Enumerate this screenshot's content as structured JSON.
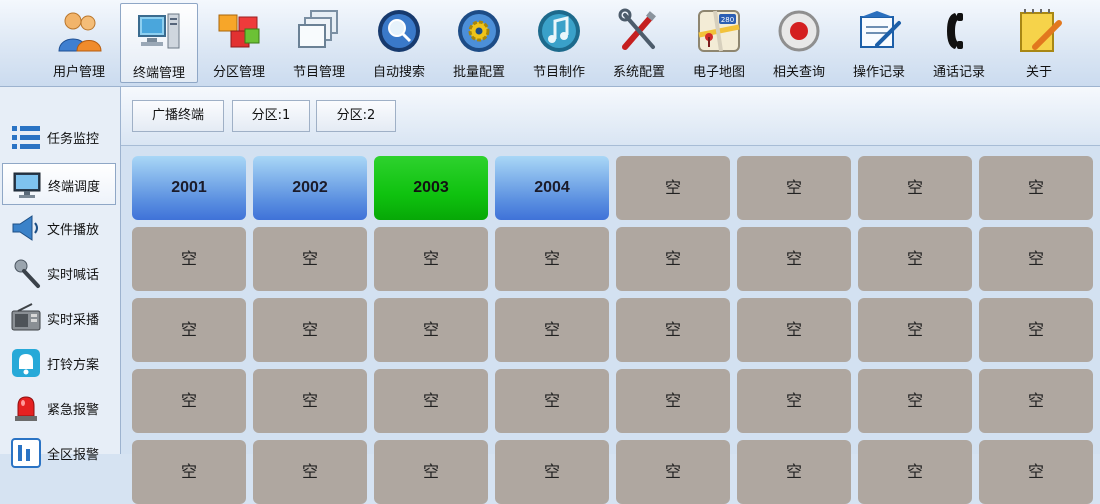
{
  "toolbar": {
    "items": [
      {
        "label": "用户管理",
        "icon": "users-icon",
        "active": false
      },
      {
        "label": "终端管理",
        "icon": "terminal-computer-icon",
        "active": true
      },
      {
        "label": "分区管理",
        "icon": "zone-cubes-icon",
        "active": false
      },
      {
        "label": "节目管理",
        "icon": "program-windows-icon",
        "active": false
      },
      {
        "label": "自动搜索",
        "icon": "search-magnifier-icon",
        "active": false
      },
      {
        "label": "批量配置",
        "icon": "batch-gear-icon",
        "active": false
      },
      {
        "label": "节目制作",
        "icon": "music-note-icon",
        "active": false
      },
      {
        "label": "系统配置",
        "icon": "tools-icon",
        "active": false
      },
      {
        "label": "电子地图",
        "icon": "map-icon",
        "active": false
      },
      {
        "label": "相关查询",
        "icon": "record-query-icon",
        "active": false
      },
      {
        "label": "操作记录",
        "icon": "operation-log-icon",
        "active": false
      },
      {
        "label": "通话记录",
        "icon": "phone-handset-icon",
        "active": false
      },
      {
        "label": "关于",
        "icon": "notepad-pencil-icon",
        "active": false
      }
    ],
    "map_badge": "280"
  },
  "sidebar": {
    "items": [
      {
        "label": "任务监控",
        "icon": "task-list-icon",
        "active": false
      },
      {
        "label": "终端调度",
        "icon": "monitor-icon",
        "active": true
      },
      {
        "label": "文件播放",
        "icon": "speaker-icon",
        "active": false
      },
      {
        "label": "实时喊话",
        "icon": "microphone-icon",
        "active": false
      },
      {
        "label": "实时采播",
        "icon": "radio-icon",
        "active": false
      },
      {
        "label": "打铃方案",
        "icon": "bell-icon",
        "active": false
      },
      {
        "label": "紧急报警",
        "icon": "alarm-light-icon",
        "active": false
      },
      {
        "label": "全区报警",
        "icon": "zone-alarm-icon",
        "active": false
      }
    ]
  },
  "tabs": [
    {
      "label": "广播终端"
    },
    {
      "label": "分区:1"
    },
    {
      "label": "分区:2"
    }
  ],
  "grid": {
    "columns": 8,
    "empty_label": "空",
    "cells": [
      {
        "label": "2001",
        "state": "terminal"
      },
      {
        "label": "2002",
        "state": "terminal"
      },
      {
        "label": "2003",
        "state": "active"
      },
      {
        "label": "2004",
        "state": "terminal"
      },
      {
        "label": "空",
        "state": "empty"
      },
      {
        "label": "空",
        "state": "empty"
      },
      {
        "label": "空",
        "state": "empty"
      },
      {
        "label": "空",
        "state": "empty"
      },
      {
        "label": "空",
        "state": "empty"
      },
      {
        "label": "空",
        "state": "empty"
      },
      {
        "label": "空",
        "state": "empty"
      },
      {
        "label": "空",
        "state": "empty"
      },
      {
        "label": "空",
        "state": "empty"
      },
      {
        "label": "空",
        "state": "empty"
      },
      {
        "label": "空",
        "state": "empty"
      },
      {
        "label": "空",
        "state": "empty"
      },
      {
        "label": "空",
        "state": "empty"
      },
      {
        "label": "空",
        "state": "empty"
      },
      {
        "label": "空",
        "state": "empty"
      },
      {
        "label": "空",
        "state": "empty"
      },
      {
        "label": "空",
        "state": "empty"
      },
      {
        "label": "空",
        "state": "empty"
      },
      {
        "label": "空",
        "state": "empty"
      },
      {
        "label": "空",
        "state": "empty"
      },
      {
        "label": "空",
        "state": "empty"
      },
      {
        "label": "空",
        "state": "empty"
      },
      {
        "label": "空",
        "state": "empty"
      },
      {
        "label": "空",
        "state": "empty"
      },
      {
        "label": "空",
        "state": "empty"
      },
      {
        "label": "空",
        "state": "empty"
      },
      {
        "label": "空",
        "state": "empty"
      },
      {
        "label": "空",
        "state": "empty"
      },
      {
        "label": "空",
        "state": "empty"
      },
      {
        "label": "空",
        "state": "empty"
      },
      {
        "label": "空",
        "state": "empty"
      },
      {
        "label": "空",
        "state": "empty"
      },
      {
        "label": "空",
        "state": "empty"
      },
      {
        "label": "空",
        "state": "empty"
      },
      {
        "label": "空",
        "state": "empty"
      },
      {
        "label": "空",
        "state": "empty"
      }
    ]
  },
  "colors": {
    "terminal": "#4f86dd",
    "active": "#10c010",
    "empty": "#afa7a0",
    "toolbar_bg": "#dce7f4"
  }
}
